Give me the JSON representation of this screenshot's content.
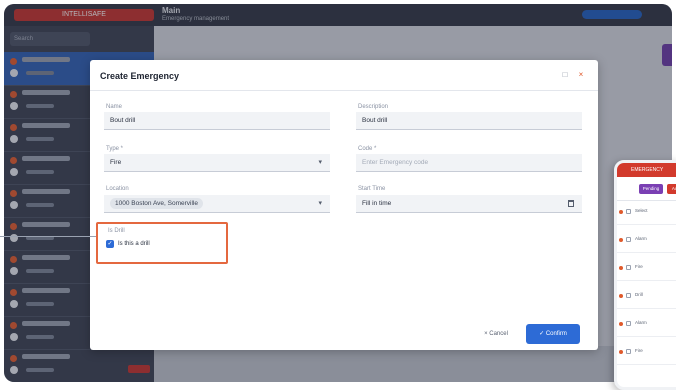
{
  "app": {
    "brand": "INTELLISAFE",
    "title": "Main",
    "subtitle": "Emergency management"
  },
  "sidebar": {
    "search_placeholder": "Search",
    "items": [
      {
        "label": "Drill",
        "active": true
      },
      {
        "label": "Fire"
      },
      {
        "label": "Alarm"
      },
      {
        "label": "Drill"
      },
      {
        "label": "Fire"
      },
      {
        "label": "Alarm"
      },
      {
        "label": "Drill"
      },
      {
        "label": "Fire"
      },
      {
        "label": "Alarm"
      },
      {
        "label": "Drill"
      }
    ]
  },
  "modal": {
    "title": "Create Emergency",
    "name_label": "Name",
    "name_value": "Bout drill",
    "description_label": "Description",
    "description_value": "Bout drill",
    "type_label": "Type *",
    "type_value": "Fire",
    "code_label": "Code *",
    "code_placeholder": "Enter Emergency code",
    "location_label": "Location",
    "location_value": "1000 Boston Ave, Somerville",
    "start_time_label": "Start Time",
    "start_time_value": "Fill in time",
    "drill_label": "Is Drill",
    "drill_checkbox_label": "Is this a drill",
    "drill_checked": true,
    "cancel_label": "Cancel",
    "confirm_label": "Confirm"
  },
  "phone": {
    "header": "EMERGENCY",
    "tab_a": "Pending",
    "tab_b": "Active",
    "rows": [
      "Select",
      "Alarm",
      "Fire",
      "Drill",
      "Alarm",
      "Fire"
    ]
  },
  "colors": {
    "accent": "#2d6bd6",
    "highlight": "#e4683f",
    "brand_red": "#c4302b"
  }
}
